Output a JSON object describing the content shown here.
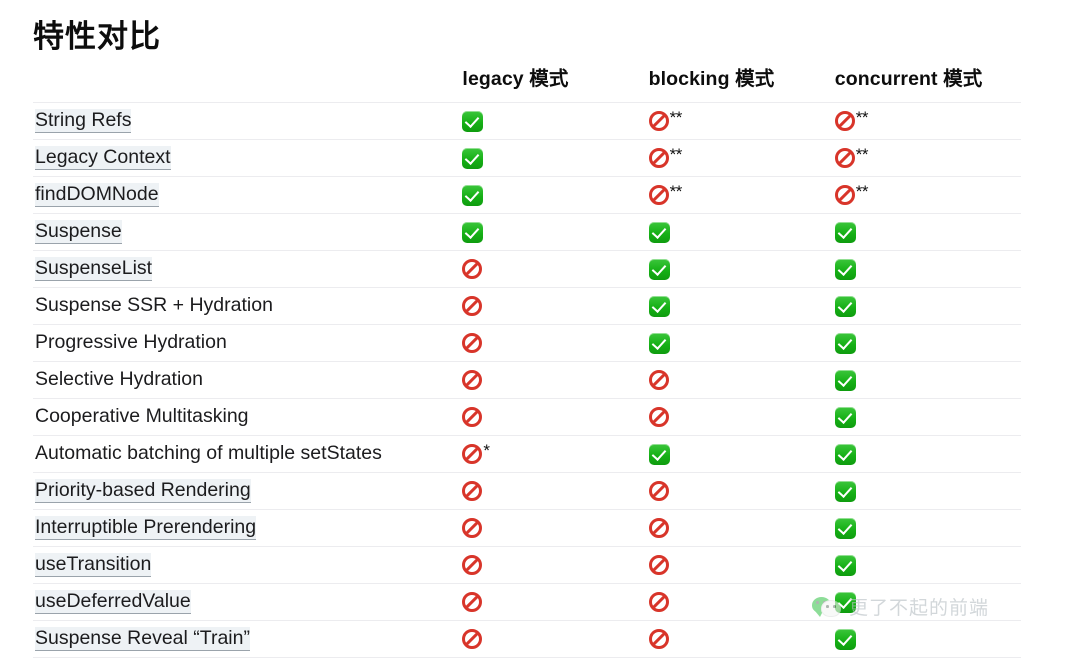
{
  "page": {
    "title": "特性对比"
  },
  "table": {
    "columns": [
      {
        "key": "feature",
        "label": ""
      },
      {
        "key": "legacy",
        "label": "legacy 模式"
      },
      {
        "key": "blocking",
        "label": "blocking 模式"
      },
      {
        "key": "concurrent",
        "label": "concurrent 模式"
      }
    ],
    "icons": {
      "yes": "green-check-emoji",
      "no": "prohibited-emoji"
    },
    "rows": [
      {
        "feature": "String Refs",
        "link": true,
        "legacy": "yes",
        "legacy_note": "",
        "blocking": "no",
        "blocking_note": "**",
        "concurrent": "no",
        "concurrent_note": "**"
      },
      {
        "feature": "Legacy Context",
        "link": true,
        "legacy": "yes",
        "legacy_note": "",
        "blocking": "no",
        "blocking_note": "**",
        "concurrent": "no",
        "concurrent_note": "**"
      },
      {
        "feature": "findDOMNode",
        "link": true,
        "legacy": "yes",
        "legacy_note": "",
        "blocking": "no",
        "blocking_note": "**",
        "concurrent": "no",
        "concurrent_note": "**"
      },
      {
        "feature": "Suspense",
        "link": true,
        "legacy": "yes",
        "legacy_note": "",
        "blocking": "yes",
        "blocking_note": "",
        "concurrent": "yes",
        "concurrent_note": ""
      },
      {
        "feature": "SuspenseList",
        "link": true,
        "legacy": "no",
        "legacy_note": "",
        "blocking": "yes",
        "blocking_note": "",
        "concurrent": "yes",
        "concurrent_note": ""
      },
      {
        "feature": "Suspense SSR + Hydration",
        "link": false,
        "legacy": "no",
        "legacy_note": "",
        "blocking": "yes",
        "blocking_note": "",
        "concurrent": "yes",
        "concurrent_note": ""
      },
      {
        "feature": "Progressive Hydration",
        "link": false,
        "legacy": "no",
        "legacy_note": "",
        "blocking": "yes",
        "blocking_note": "",
        "concurrent": "yes",
        "concurrent_note": ""
      },
      {
        "feature": "Selective Hydration",
        "link": false,
        "legacy": "no",
        "legacy_note": "",
        "blocking": "no",
        "blocking_note": "",
        "concurrent": "yes",
        "concurrent_note": ""
      },
      {
        "feature": "Cooperative Multitasking",
        "link": false,
        "legacy": "no",
        "legacy_note": "",
        "blocking": "no",
        "blocking_note": "",
        "concurrent": "yes",
        "concurrent_note": ""
      },
      {
        "feature": "Automatic batching of multiple setStates",
        "link": false,
        "legacy": "no",
        "legacy_note": "*",
        "blocking": "yes",
        "blocking_note": "",
        "concurrent": "yes",
        "concurrent_note": ""
      },
      {
        "feature": "Priority-based Rendering",
        "link": true,
        "legacy": "no",
        "legacy_note": "",
        "blocking": "no",
        "blocking_note": "",
        "concurrent": "yes",
        "concurrent_note": ""
      },
      {
        "feature": "Interruptible Prerendering",
        "link": true,
        "legacy": "no",
        "legacy_note": "",
        "blocking": "no",
        "blocking_note": "",
        "concurrent": "yes",
        "concurrent_note": ""
      },
      {
        "feature": "useTransition",
        "link": true,
        "legacy": "no",
        "legacy_note": "",
        "blocking": "no",
        "blocking_note": "",
        "concurrent": "yes",
        "concurrent_note": ""
      },
      {
        "feature": "useDeferredValue",
        "link": true,
        "legacy": "no",
        "legacy_note": "",
        "blocking": "no",
        "blocking_note": "",
        "concurrent": "yes",
        "concurrent_note": ""
      },
      {
        "feature": "Suspense Reveal “Train”",
        "link": true,
        "legacy": "no",
        "legacy_note": "",
        "blocking": "no",
        "blocking_note": "",
        "concurrent": "yes",
        "concurrent_note": ""
      }
    ]
  },
  "watermark": {
    "icon": "wechat-logo-icon",
    "text": "更了不起的前端"
  },
  "colors": {
    "yes": "#16b016",
    "no": "#d8352a",
    "row_divider": "#ececef",
    "link_background": "#eef2f5",
    "link_underline": "#9aa3ab",
    "text": "#1c1c1e",
    "watermark_text": "#b8bfc4",
    "watermark_logo": "#49c95a"
  }
}
